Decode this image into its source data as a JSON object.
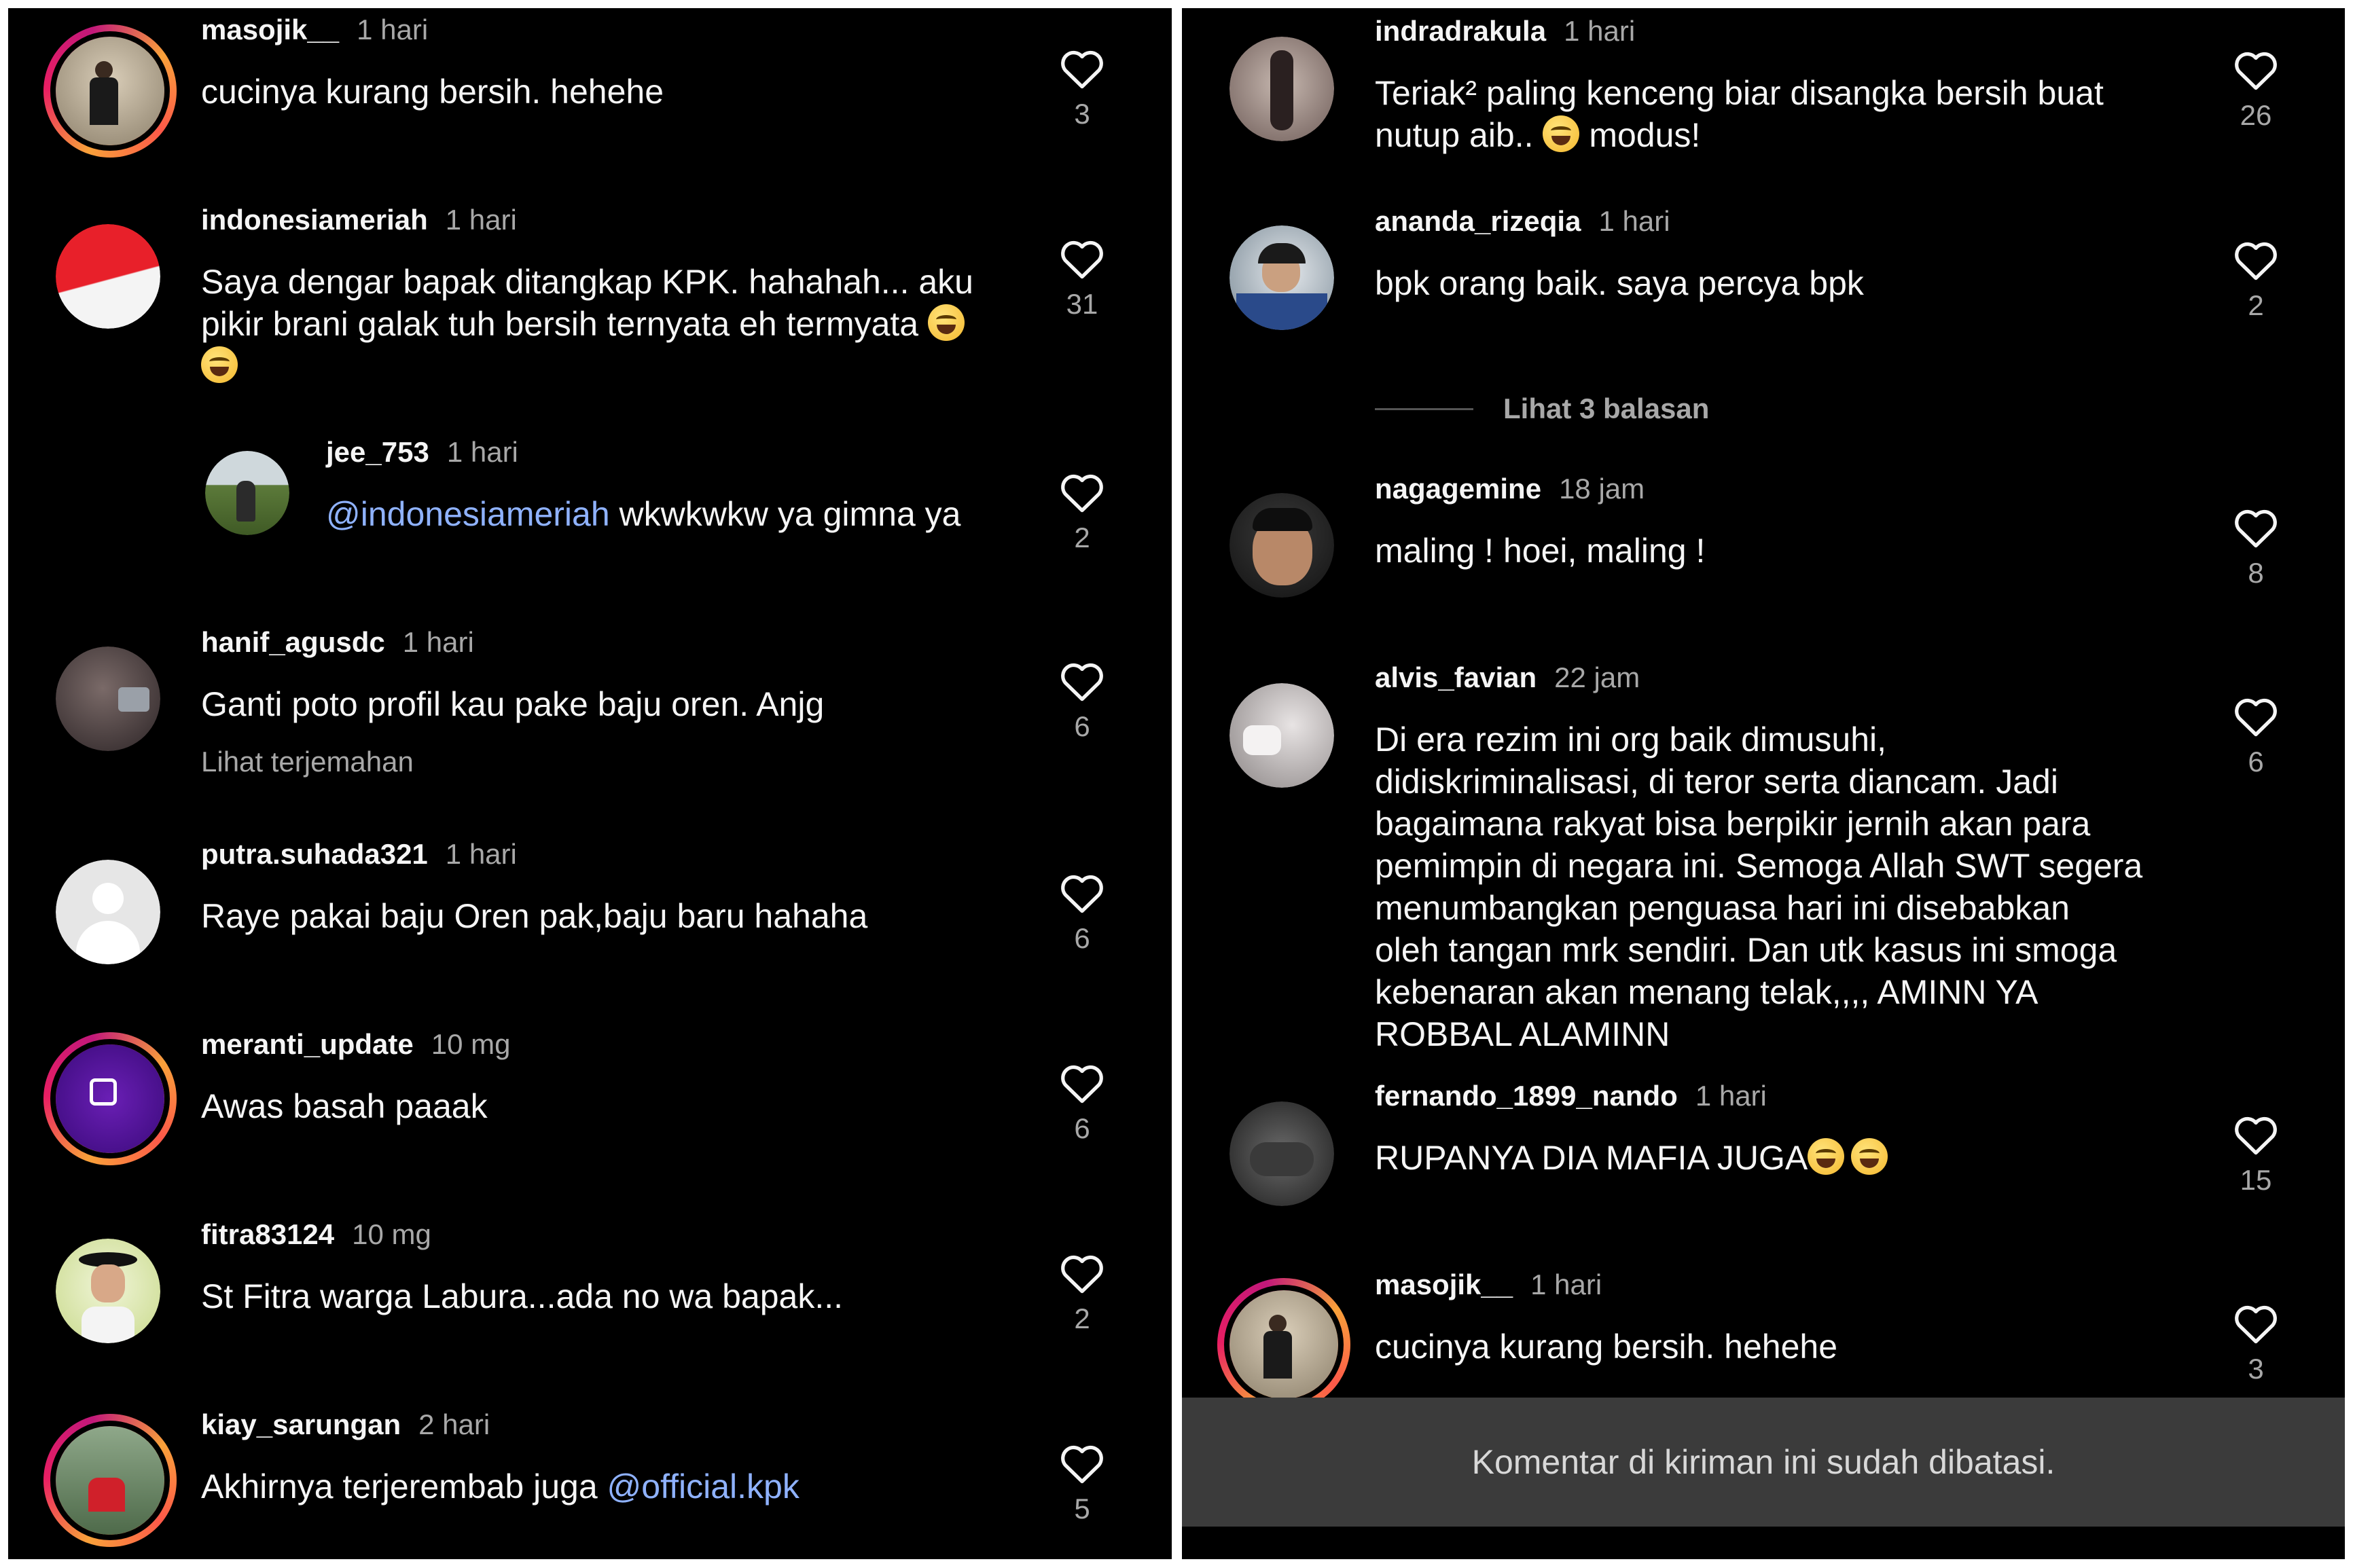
{
  "left_panel": {
    "comments": [
      {
        "username": "masojik__",
        "time": "1 hari",
        "text": "cucinya kurang bersih. hehehe",
        "likes": "3"
      },
      {
        "username": "indonesiameriah",
        "time": "1 hari",
        "text_line1": "Saya dengar bapak ditangkap KPK. hahahah... aku",
        "text_line2": "pikir brani galak tuh bersih ternyata eh termyata",
        "likes": "31"
      },
      {
        "username": "jee_753",
        "time": "1 hari",
        "mention": "@indonesiameriah",
        "text": " wkwkwkw ya gimna ya",
        "likes": "2"
      },
      {
        "username": "hanif_agusdc",
        "time": "1 hari",
        "text": "Ganti poto profil kau pake baju oren. Anjg",
        "translate": "Lihat terjemahan",
        "likes": "6"
      },
      {
        "username": "putra.suhada321",
        "time": "1 hari",
        "text": "Raye pakai baju Oren pak,baju baru hahaha",
        "likes": "6"
      },
      {
        "username": "meranti_update",
        "time": "10 mg",
        "text": "Awas basah paaak",
        "likes": "6"
      },
      {
        "username": "fitra83124",
        "time": "10 mg",
        "text": "St Fitra warga Labura...ada no wa bapak...",
        "likes": "2"
      },
      {
        "username": "kiay_sarungan",
        "time": "2 hari",
        "text": "Akhirnya terjerembab juga ",
        "mention": "@official.kpk",
        "likes": "5"
      }
    ]
  },
  "right_panel": {
    "comments": [
      {
        "username": "indradrakula",
        "time": "1 hari",
        "text_line1": "Teriak² paling kenceng biar disangka bersih buat",
        "text_line2a": "nutup aib.. ",
        "text_line2b": " modus!",
        "likes": "26"
      },
      {
        "username": "ananda_rizeqia",
        "time": "1 hari",
        "text": "bpk orang baik. saya percya bpk",
        "likes": "2"
      },
      {
        "username": "nagagemine",
        "time": "18 jam",
        "text": "maling ! hoei, maling !",
        "likes": "8"
      },
      {
        "username": "alvis_favian",
        "time": "22 jam",
        "lines": [
          "Di era rezim ini org baik dimusuhi,",
          "didiskriminalisasi, di teror serta diancam. Jadi",
          "bagaimana rakyat bisa berpikir jernih akan para",
          "pemimpin di negara ini. Semoga Allah SWT segera",
          "menumbangkan penguasa hari ini disebabkan",
          "oleh tangan mrk sendiri. Dan utk kasus ini smoga",
          "kebenaran akan menang telak,,,, AMINN YA",
          "ROBBAL ALAMINN"
        ],
        "likes": "6"
      },
      {
        "username": "fernando_1899_nando",
        "time": "1 hari",
        "text": "RUPANYA DIA MAFIA JUGA",
        "likes": "15"
      },
      {
        "username": "masojik__",
        "time": "1 hari",
        "text": "cucinya kurang bersih. hehehe",
        "likes": "3"
      }
    ],
    "view_replies": "Lihat 3 balasan",
    "restricted_notice": "Komentar di kiriman ini sudah dibatasi."
  },
  "colors": {
    "background": "#000000",
    "text": "#f5f5f5",
    "secondary": "#a8a8a8",
    "mention": "#8fb2ff",
    "notice_bar": "#3b3b3b"
  },
  "icons": {
    "like": "heart-outline-icon"
  }
}
